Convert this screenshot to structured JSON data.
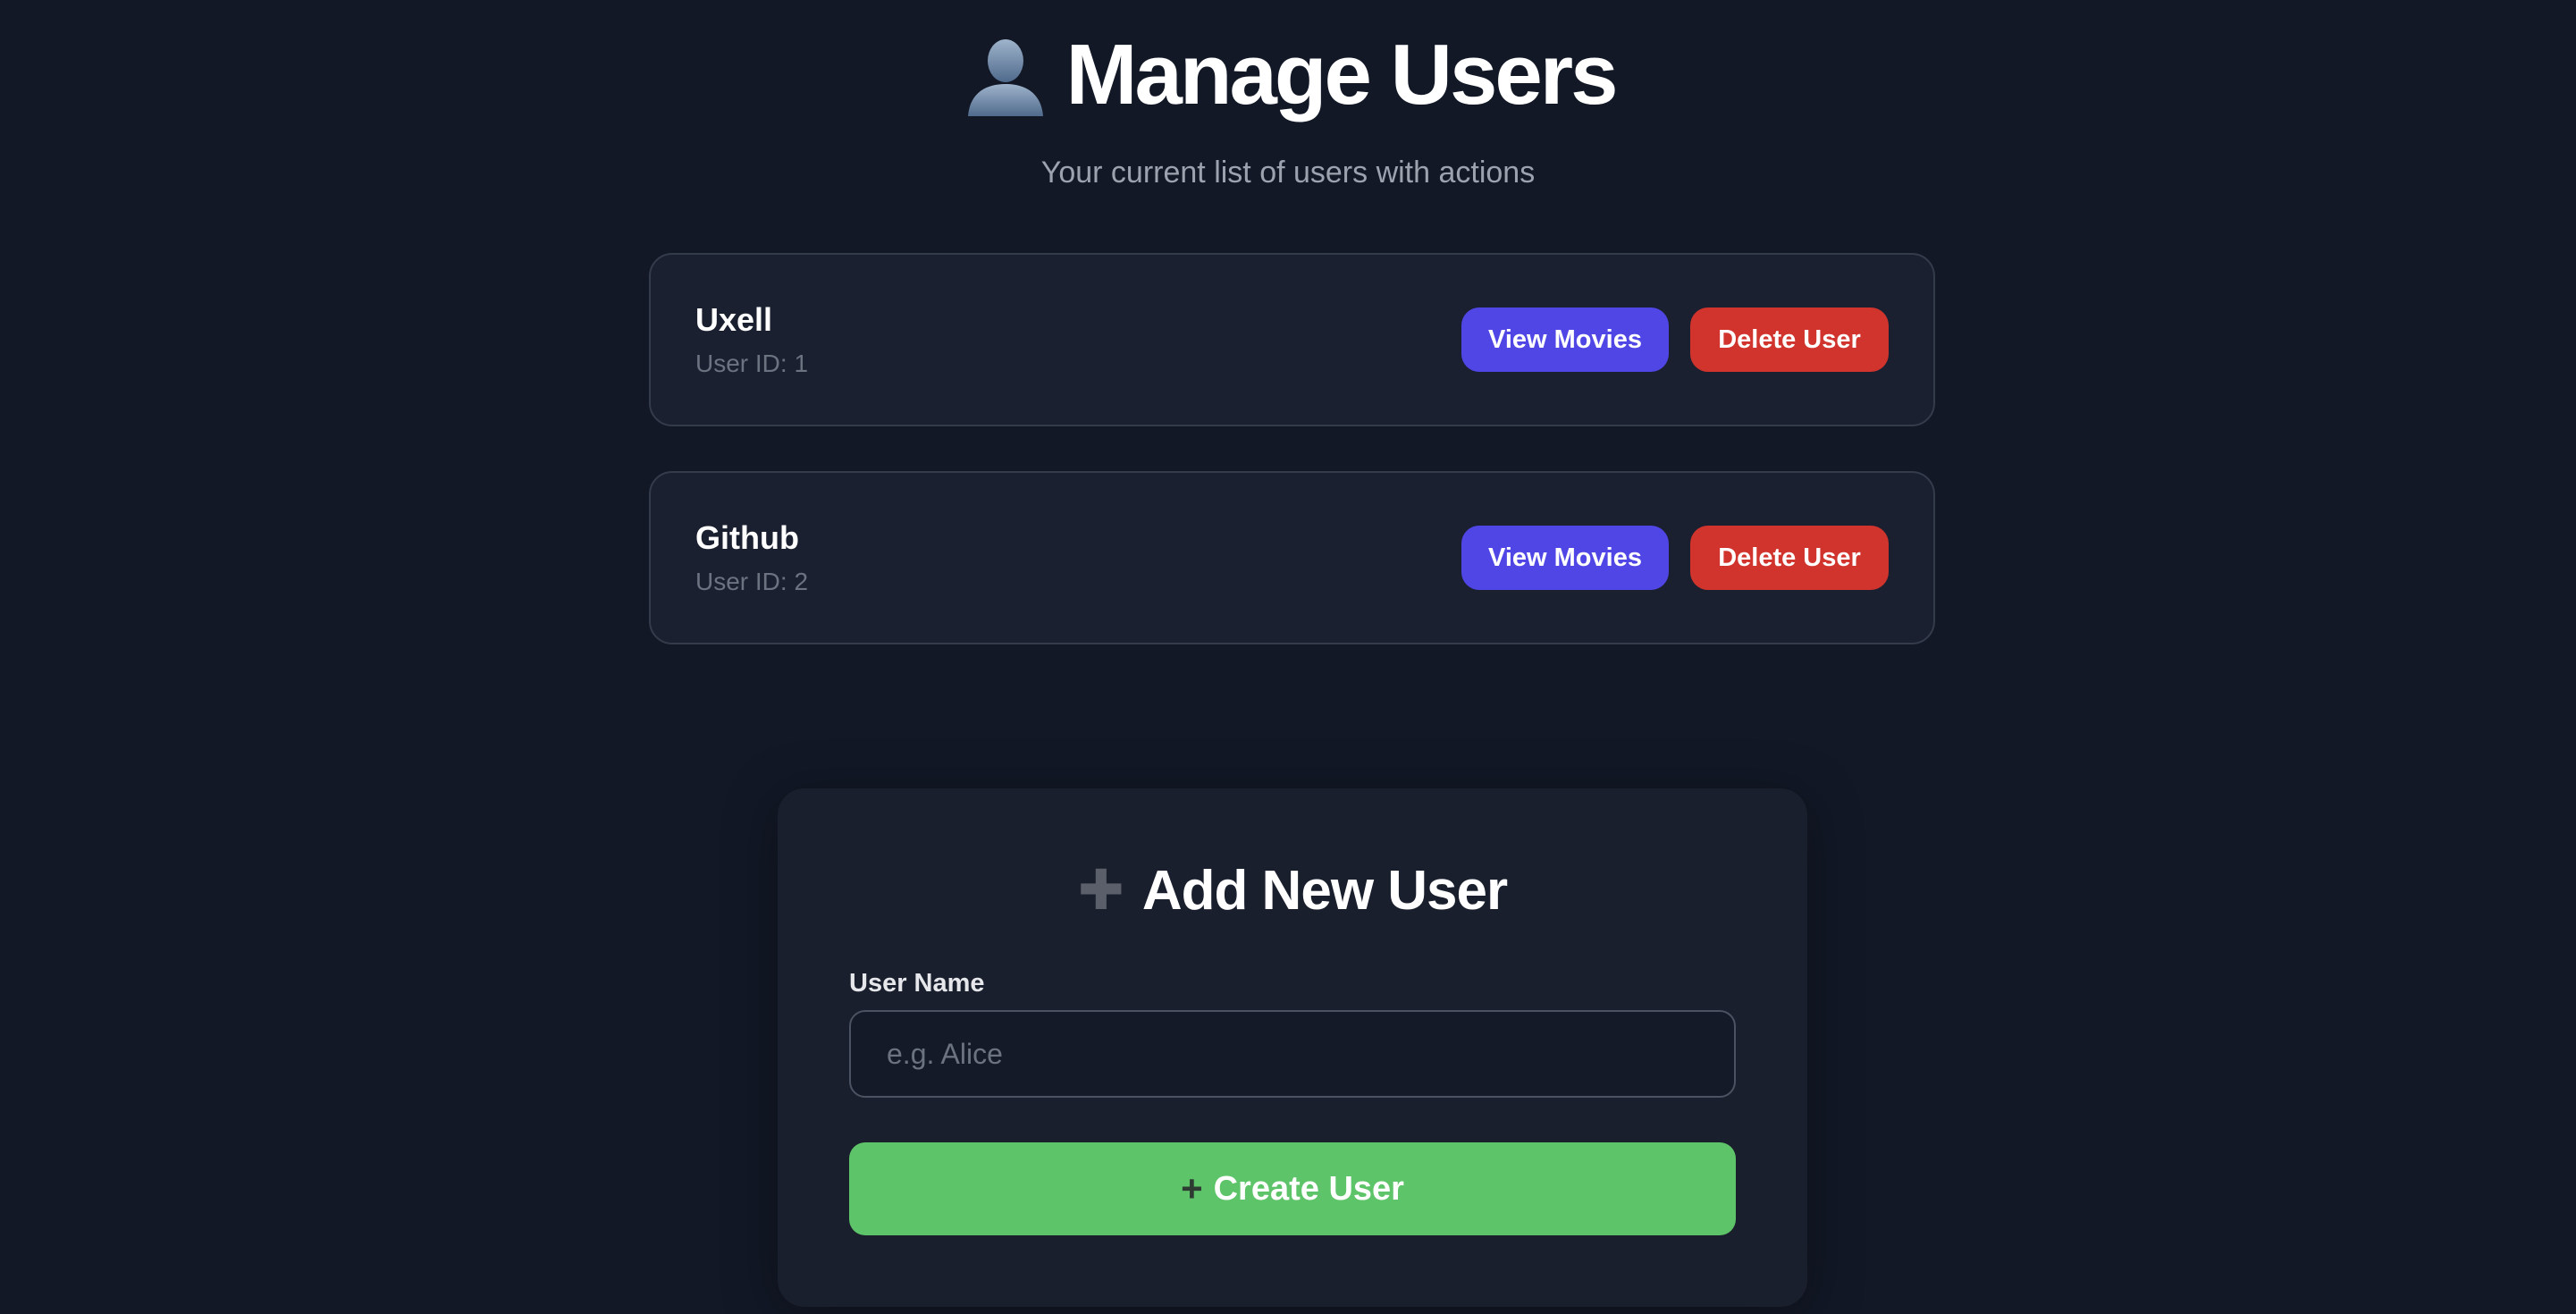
{
  "header": {
    "title": "Manage Users",
    "subtitle": "Your current list of users with actions",
    "icon": "user-silhouette-icon"
  },
  "users": [
    {
      "name": "Uxell",
      "id_label": "User ID: 1",
      "view_label": "View Movies",
      "delete_label": "Delete User"
    },
    {
      "name": "Github",
      "id_label": "User ID: 2",
      "view_label": "View Movies",
      "delete_label": "Delete User"
    }
  ],
  "add_user": {
    "icon": "plus-icon",
    "title": "Add New User",
    "field_label": "User Name",
    "placeholder": "e.g. Alice",
    "value": "",
    "submit_icon": "+",
    "submit_label": "Create User"
  },
  "colors": {
    "background": "#121826",
    "card": "#1b2030",
    "view_button": "#4f46e5",
    "delete_button": "#d0342c",
    "create_button": "#5ec469",
    "muted_text": "#6b7280"
  }
}
